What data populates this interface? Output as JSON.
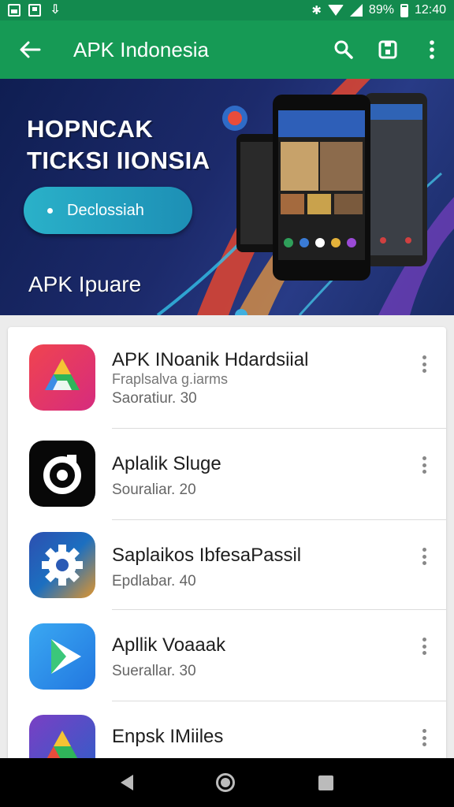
{
  "status_bar": {
    "battery": "89%",
    "time": "12:40"
  },
  "app_bar": {
    "title": "APK Indonesia"
  },
  "banner": {
    "title_line1": "HOPNCAK",
    "title_line2": "TICKSI IIONSIA",
    "button_label": "Declossiah",
    "subtitle": "APK Ipuare"
  },
  "apps": [
    {
      "title": "APK INoanik Hdardsiial",
      "subtitle": "Fraplsalva g.iarms",
      "meta": "Saoratiur. 30",
      "icon": "drive-triangle-icon"
    },
    {
      "title": "Aplalik Sluge",
      "subtitle": "",
      "meta": "Souraliar. 20",
      "icon": "ring-camera-icon"
    },
    {
      "title": "Saplaikos IbfesaPassil",
      "subtitle": "",
      "meta": "Epdlabar. 40",
      "icon": "gear-icon"
    },
    {
      "title": "Apllik Voaaak",
      "subtitle": "",
      "meta": "Suerallar. 30",
      "icon": "play-triangle-icon"
    },
    {
      "title": "Enpsk IMiiles",
      "subtitle": "",
      "meta": "",
      "icon": "drive-triangle-icon"
    }
  ],
  "colors": {
    "app_bar": "#169a55",
    "status_bar": "#138a4e",
    "banner_button": "#2ab1c9"
  }
}
